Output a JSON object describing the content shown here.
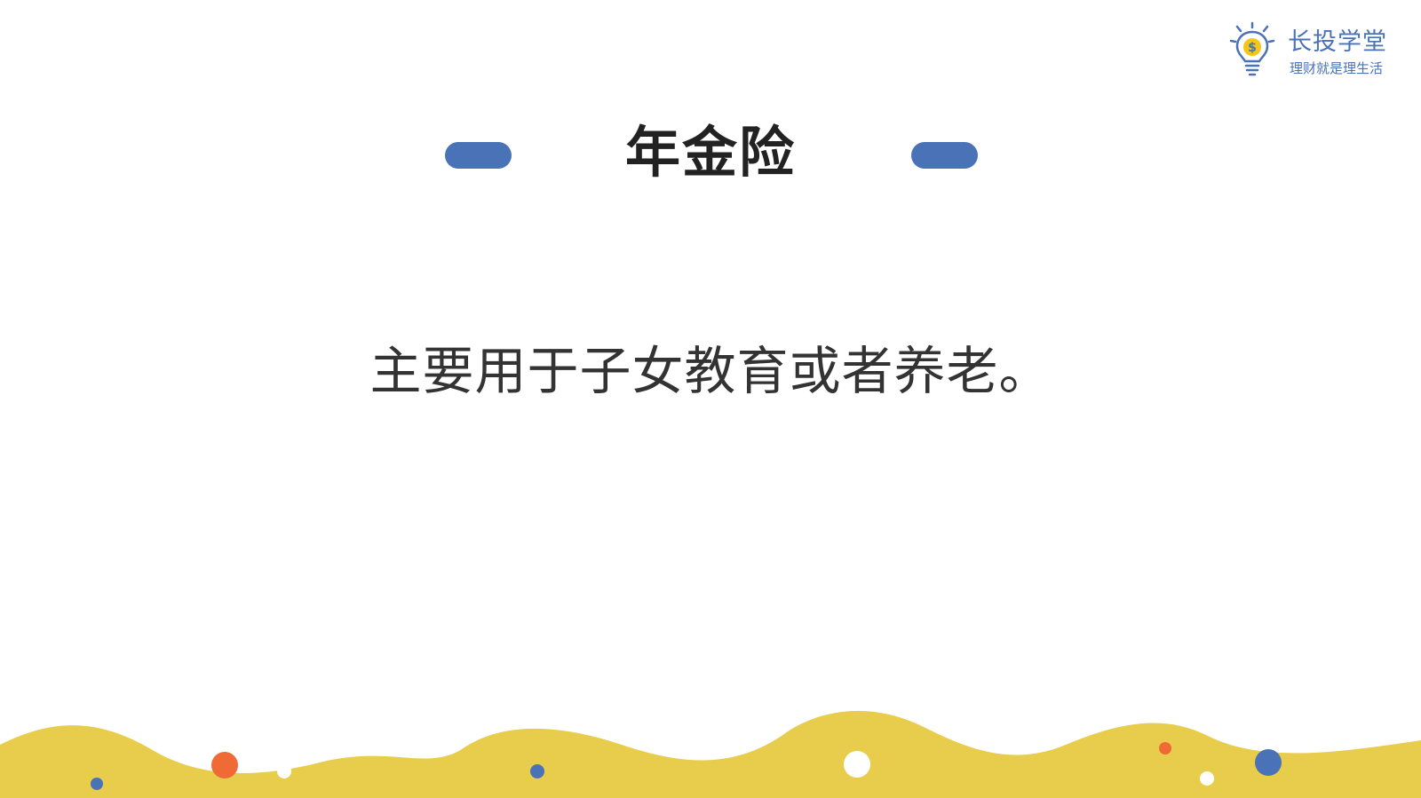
{
  "logo": {
    "title": "长投学堂",
    "slogan": "理财就是理生活",
    "mark_icon": "lightbulb-dollar-icon",
    "color": "#4a72b7",
    "accent": "#f5c518"
  },
  "slide": {
    "title": "年金险",
    "body": "主要用于子女教育或者养老。"
  },
  "colors": {
    "pill": "#4a72b7",
    "wave": "#e8cc4c",
    "dot_orange": "#ef6a35",
    "dot_blue": "#4a72b7",
    "dot_white": "#ffffff",
    "title_text": "#222222",
    "body_text": "#333333"
  }
}
